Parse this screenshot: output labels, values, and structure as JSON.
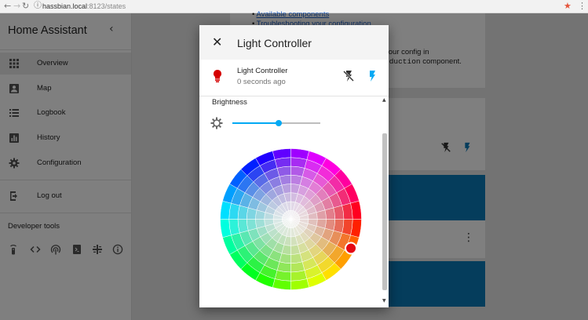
{
  "browser": {
    "back_icon": "arrow-left-icon",
    "forward_icon": "arrow-right-icon",
    "reload_icon": "reload-icon",
    "url_host": "hassbian.local",
    "url_rest": ":8123/states",
    "bookmark_icon": "star-icon",
    "bookmark_color": "#e5553c"
  },
  "sidebar": {
    "title": "Home Assistant",
    "items": [
      {
        "label": "Overview",
        "icon": "grid-icon",
        "active": true
      },
      {
        "label": "Map",
        "icon": "map-person-icon"
      },
      {
        "label": "Logbook",
        "icon": "list-icon"
      },
      {
        "label": "History",
        "icon": "chart-icon"
      },
      {
        "label": "Configuration",
        "icon": "gear-icon"
      }
    ],
    "logout": {
      "label": "Log out",
      "icon": "logout-icon"
    },
    "dev_tools": {
      "title": "Developer tools",
      "icons": [
        "remote-icon",
        "code-icon",
        "antenna-icon",
        "template-icon",
        "mqtt-icon",
        "info-icon"
      ]
    }
  },
  "background": {
    "link1": "Available components",
    "link2": "Troubleshooting your configuration",
    "line1": "your config in",
    "line2_code": "oduction",
    "line2_rest": " component."
  },
  "dialog": {
    "title": "Light Controller",
    "close_icon": "close-icon",
    "entity": {
      "name": "Light Controller",
      "time": "0 seconds ago",
      "icon": "lightbulb-icon",
      "state_color": "#d50000"
    },
    "brightness_label": "Brightness",
    "brightness_value": 0.53,
    "accent_color": "#03a9f4",
    "selected_color": "#e50914"
  }
}
